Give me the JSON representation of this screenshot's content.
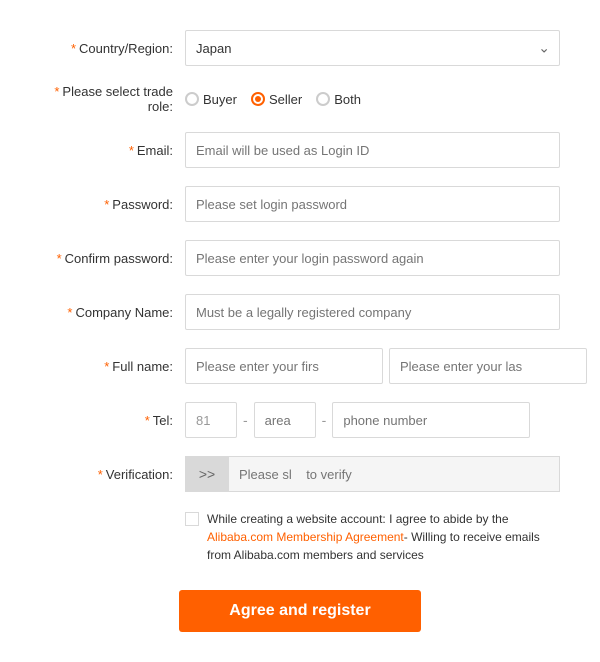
{
  "form": {
    "country_label": "Country/Region:",
    "country_value": "Japan",
    "trade_role_label": "Please select trade role:",
    "trade_roles": [
      {
        "id": "buyer",
        "label": "Buyer",
        "checked": false
      },
      {
        "id": "seller",
        "label": "Seller",
        "checked": true
      },
      {
        "id": "both",
        "label": "Both",
        "checked": false
      }
    ],
    "email_label": "Email:",
    "email_placeholder": "Email will be used as Login ID",
    "password_label": "Password:",
    "password_placeholder": "Please set login password",
    "confirm_password_label": "Confirm password:",
    "confirm_password_placeholder": "Please enter your login password again",
    "company_name_label": "Company Name:",
    "company_name_placeholder": "Must be a legally registered company",
    "full_name_label": "Full name:",
    "first_name_placeholder": "Please enter your firs",
    "last_name_placeholder": "Please enter your las",
    "tel_label": "Tel:",
    "tel_code_value": "81",
    "tel_area_placeholder": "area",
    "tel_number_placeholder": "phone number",
    "verification_label": "Verification:",
    "verify_btn_label": ">>",
    "verify_placeholder": "Please sl    to verify",
    "agreement_text_1": "While creating a website account: I agree to abide by the ",
    "agreement_link": "Alibaba.com Membership Agreement",
    "agreement_text_2": "- Willing to receive emails from Alibaba.com members and services",
    "register_btn": "Agree and register"
  }
}
